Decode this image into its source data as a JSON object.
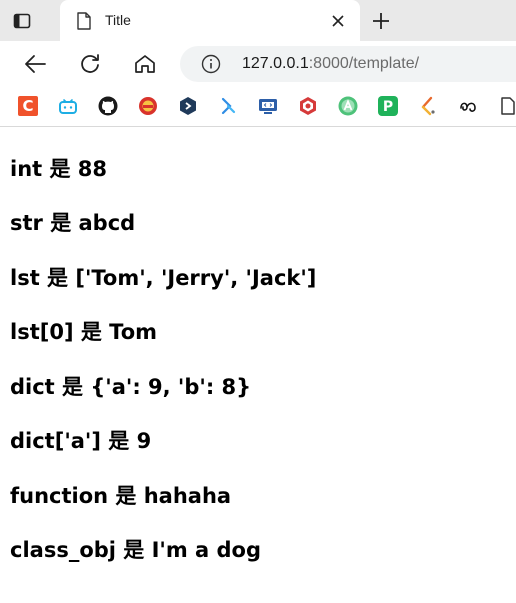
{
  "tab": {
    "title": "Title",
    "close_glyph": "✕",
    "new_tab_glyph": "+"
  },
  "address_bar": {
    "host": "127.0.0.1",
    "rest": ":8000/template/"
  },
  "bookmarks": [
    {
      "name": "csdn-icon",
      "color": "#f0522b",
      "glyph": "C"
    },
    {
      "name": "bilibili-icon",
      "color": "#1eaee4",
      "glyph": ""
    },
    {
      "name": "github-icon",
      "color": "#1a1a1a",
      "glyph": ""
    },
    {
      "name": "shield-badge-icon",
      "color": "#d9332b",
      "glyph": ""
    },
    {
      "name": "hexagon-code-icon",
      "color": "#1f3a5a",
      "glyph": ""
    },
    {
      "name": "blue-arrows-icon",
      "color": "#2f8de4",
      "glyph": ""
    },
    {
      "name": "monitor-code-icon",
      "color": "#2d5fa8",
      "glyph": ""
    },
    {
      "name": "red-hexagon-icon",
      "color": "#d63a3a",
      "glyph": ""
    },
    {
      "name": "green-circle-a-icon",
      "color": "#4ec27a",
      "glyph": "A"
    },
    {
      "name": "green-p-icon",
      "color": "#1fb25a",
      "glyph": "P"
    },
    {
      "name": "slash-colored-icon",
      "color": "#e8692c",
      "glyph": ""
    },
    {
      "name": "script-symbol-icon",
      "color": "#111111",
      "glyph": "ಹ"
    },
    {
      "name": "page-icon",
      "color": "#333333",
      "glyph": ""
    }
  ],
  "lines": [
    "int 是 88",
    "str 是 abcd",
    "lst 是 ['Tom', 'Jerry', 'Jack']",
    "lst[0] 是 Tom",
    "dict 是 {'a': 9, 'b': 8}",
    "dict['a'] 是 9",
    "function 是 hahaha",
    "class_obj 是 I'm a dog"
  ]
}
